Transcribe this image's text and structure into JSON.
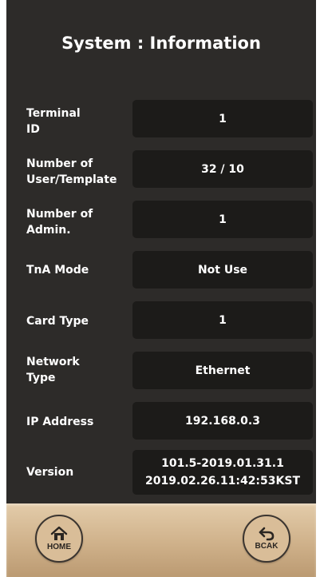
{
  "screen": {
    "title": "System : Information"
  },
  "rows": [
    {
      "label_line1": "Terminal",
      "label_line2": "ID",
      "value_line1": "1",
      "value_line2": ""
    },
    {
      "label_line1": "Number of",
      "label_line2": "User/Template",
      "value_line1": "32 / 10",
      "value_line2": ""
    },
    {
      "label_line1": "Number of",
      "label_line2": "Admin.",
      "value_line1": "1",
      "value_line2": ""
    },
    {
      "label_line1": "TnA Mode",
      "label_line2": "",
      "value_line1": "Not Use",
      "value_line2": ""
    },
    {
      "label_line1": "Card Type",
      "label_line2": "",
      "value_line1": "1",
      "value_line2": ""
    },
    {
      "label_line1": "Network",
      "label_line2": "Type",
      "value_line1": "Ethernet",
      "value_line2": ""
    },
    {
      "label_line1": "IP Address",
      "label_line2": "",
      "value_line1": "192.168.0.3",
      "value_line2": ""
    },
    {
      "label_line1": "Version",
      "label_line2": "",
      "value_line1": "101.5-2019.01.31.1",
      "value_line2": "2019.02.26.11:42:53KST"
    }
  ],
  "footer": {
    "home": {
      "label": "HOME",
      "icon": "home-icon"
    },
    "back": {
      "label": "BCAK",
      "icon": "back-arrow-icon"
    }
  },
  "colors": {
    "background": "#2d2b29",
    "value_box": "#1c1b19",
    "footer": "#cfb18a"
  }
}
